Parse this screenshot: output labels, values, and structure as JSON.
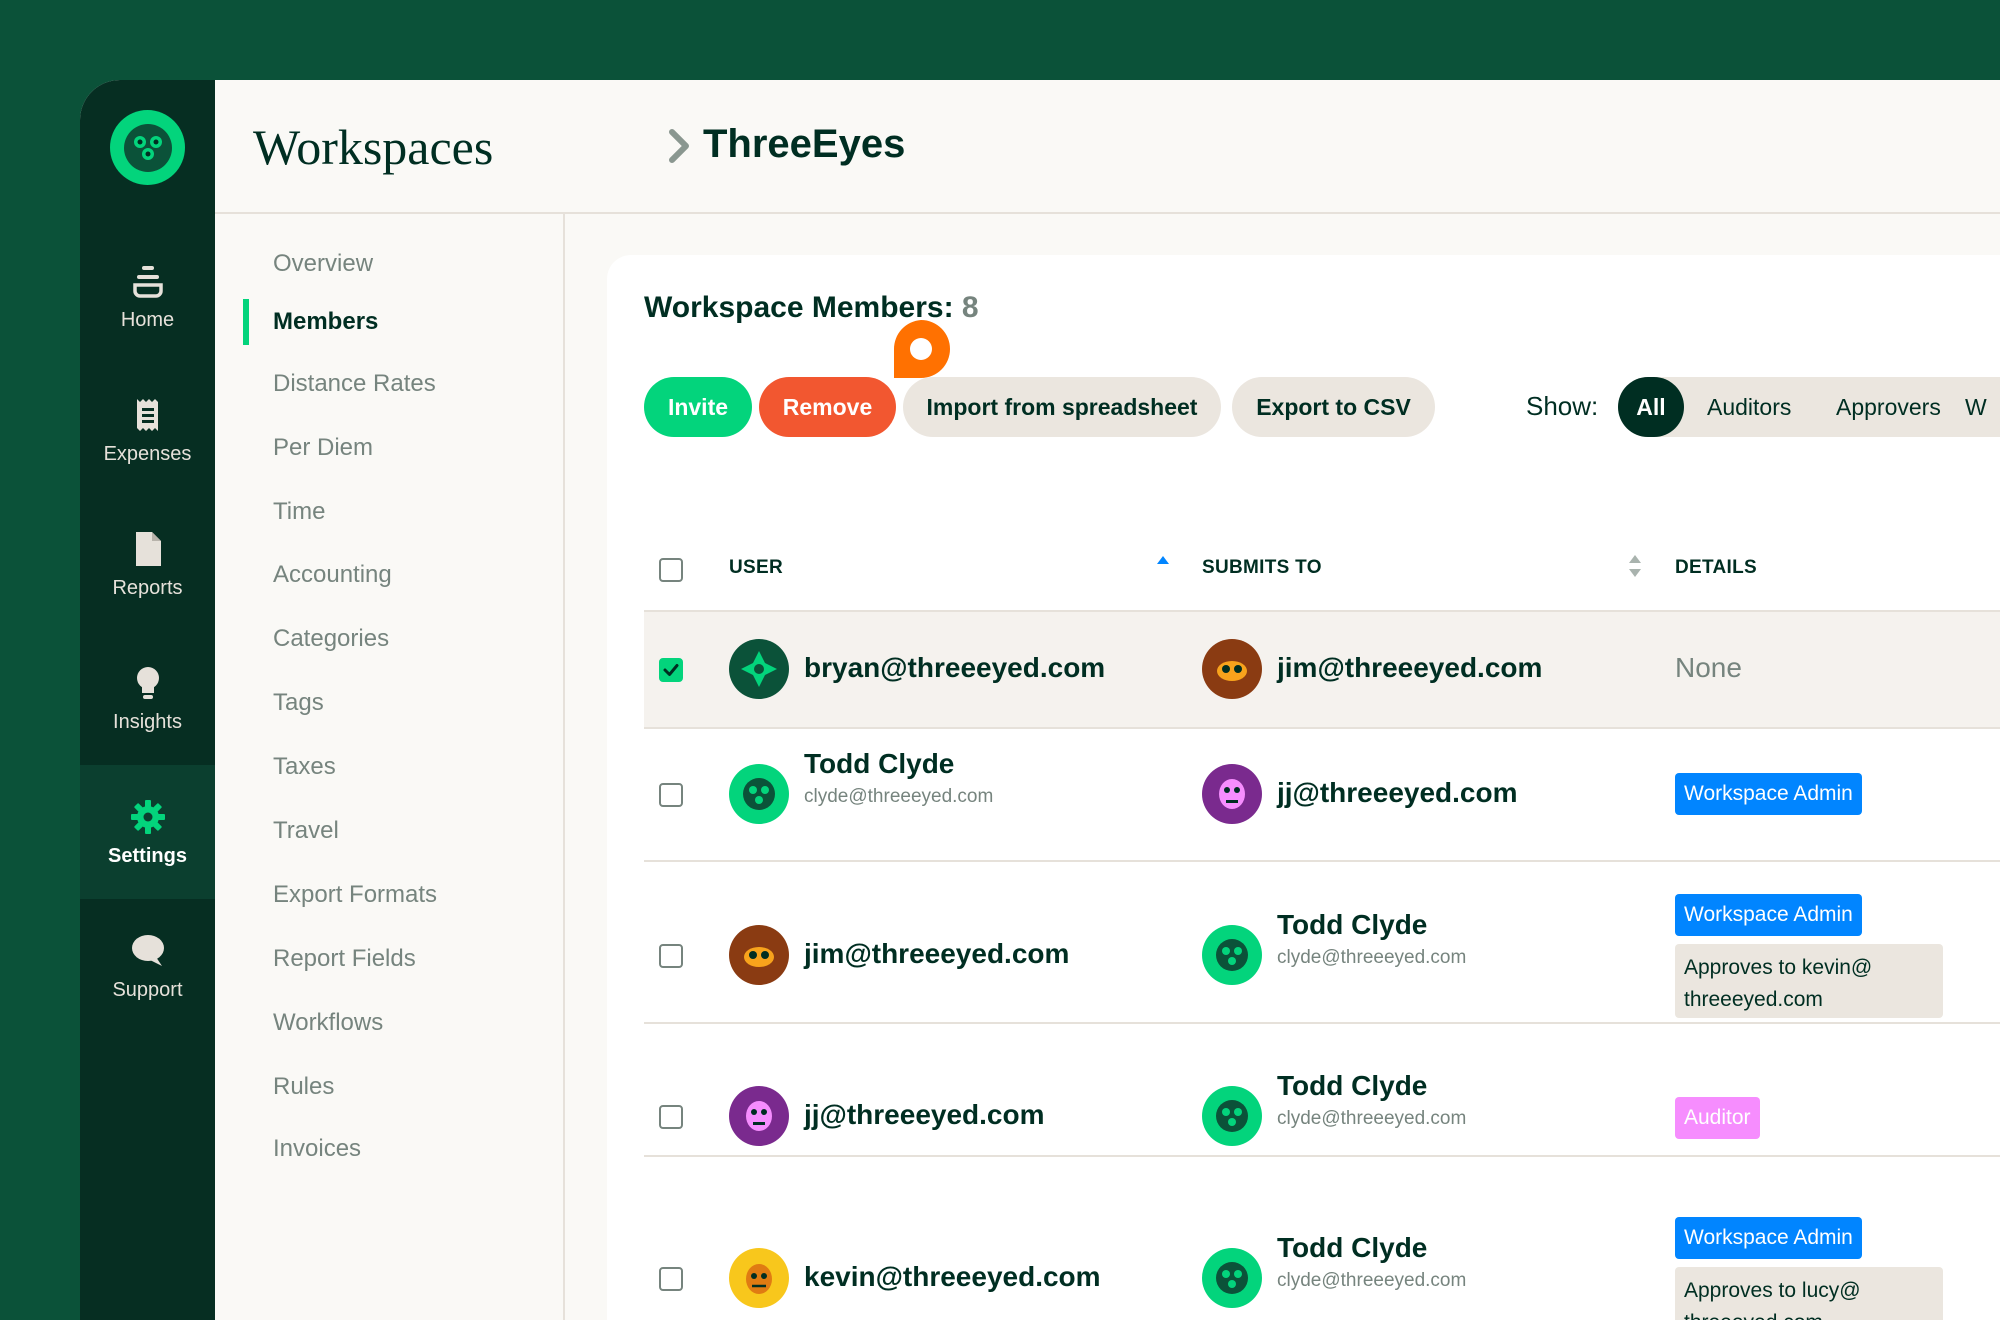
{
  "nav": {
    "items": [
      {
        "label": "Home",
        "icon": "home-icon"
      },
      {
        "label": "Expenses",
        "icon": "receipt-icon"
      },
      {
        "label": "Reports",
        "icon": "document-icon"
      },
      {
        "label": "Insights",
        "icon": "lightbulb-icon"
      },
      {
        "label": "Settings",
        "icon": "gear-icon",
        "active": true
      },
      {
        "label": "Support",
        "icon": "chat-bubble-icon"
      }
    ]
  },
  "header": {
    "breadcrumb_root": "Workspaces",
    "breadcrumb_current": "ThreeEyes"
  },
  "subnav": {
    "items": [
      "Overview",
      "Members",
      "Distance Rates",
      "Per Diem",
      "Time",
      "Accounting",
      "Categories",
      "Tags",
      "Taxes",
      "Travel",
      "Export Formats",
      "Report Fields",
      "Workflows",
      "Rules",
      "Invoices"
    ],
    "active": "Members"
  },
  "members": {
    "title": "Workspace Members:",
    "count": "8",
    "actions": {
      "invite": "Invite",
      "remove": "Remove",
      "import": "Import from spreadsheet",
      "export": "Export to CSV"
    },
    "show_label": "Show:",
    "filters": [
      "All",
      "Auditors",
      "Approvers",
      "W"
    ],
    "active_filter": "All",
    "columns": {
      "user": "USER",
      "submits_to": "SUBMITS TO",
      "details": "DETAILS"
    },
    "rows": [
      {
        "selected": true,
        "user_name": "bryan@threeeyed.com",
        "submits_name": "jim@threeeyed.com",
        "details_text": "None"
      },
      {
        "selected": false,
        "user_name": "Todd Clyde",
        "user_email": "clyde@threeeyed.com",
        "submits_name": "jj@threeeyed.com",
        "badge": "Workspace Admin"
      },
      {
        "selected": false,
        "user_name": "jim@threeeyed.com",
        "submits_name": "Todd Clyde",
        "submits_email": "clyde@threeeyed.com",
        "badge": "Workspace Admin",
        "approves": "Approves to kevin@ threeeyed.com"
      },
      {
        "selected": false,
        "user_name": "jj@threeeyed.com",
        "submits_name": "Todd Clyde",
        "submits_email": "clyde@threeeyed.com",
        "badge": "Auditor"
      },
      {
        "selected": false,
        "user_name": "kevin@threeeyed.com",
        "submits_name": "Todd Clyde",
        "submits_email": "clyde@threeeyed.com",
        "badge": "Workspace Admin",
        "approves": "Approves to lucy@ threeeyed.com"
      }
    ]
  },
  "colors": {
    "brand_green": "#03d47c",
    "dark_green": "#002e22",
    "danger": "#f25730",
    "admin_blue": "#0185ff",
    "auditor_pink": "#f68dfe",
    "pin_orange": "#ff7101"
  }
}
